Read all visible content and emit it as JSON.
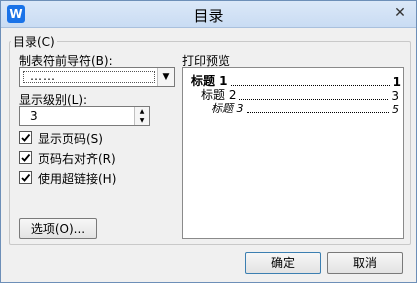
{
  "window": {
    "title": "目录",
    "icon_letter": "W"
  },
  "group": {
    "label": "目录(C)"
  },
  "leader": {
    "label": "制表符前导符(B):",
    "value": "……",
    "options_hint": "dropdown"
  },
  "levels": {
    "label": "显示级别(L):",
    "value": "3"
  },
  "checkboxes": [
    {
      "label": "显示页码(S)",
      "checked": true
    },
    {
      "label": "页码右对齐(R)",
      "checked": true
    },
    {
      "label": "使用超链接(H)",
      "checked": true
    }
  ],
  "options_button": "选项(O)...",
  "preview": {
    "label": "打印预览",
    "entries": [
      {
        "title": "标题 1",
        "page": "1"
      },
      {
        "title": "标题 2",
        "page": "3"
      },
      {
        "title": "标题 3",
        "page": "5"
      }
    ]
  },
  "buttons": {
    "ok": "确定",
    "cancel": "取消"
  }
}
